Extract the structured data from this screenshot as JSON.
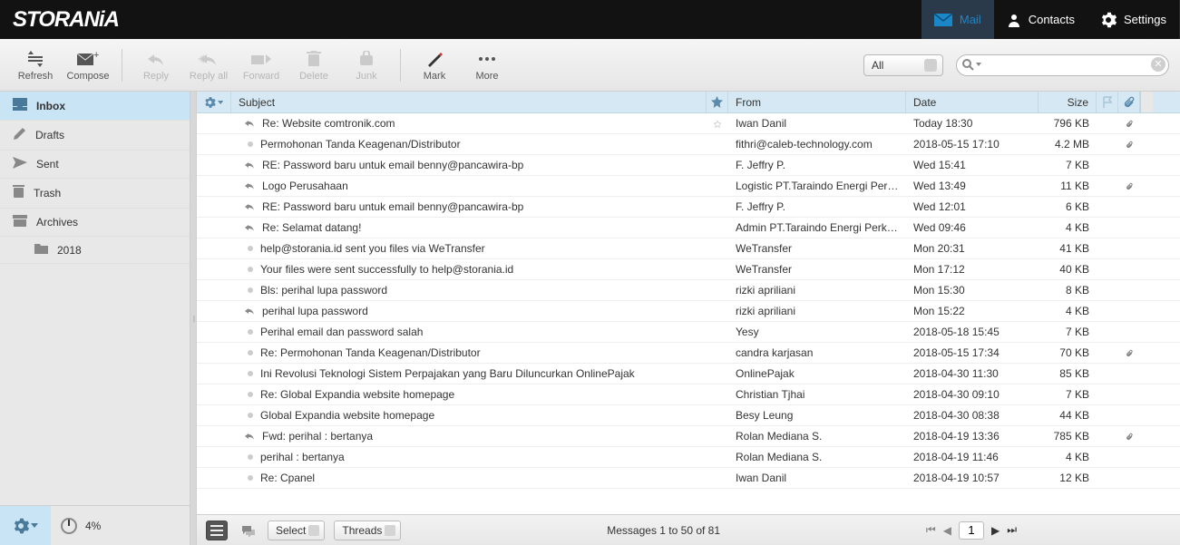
{
  "app": {
    "name": "STORANiA"
  },
  "topnav": {
    "mail": "Mail",
    "contacts": "Contacts",
    "settings": "Settings"
  },
  "toolbar": {
    "refresh": "Refresh",
    "compose": "Compose",
    "reply": "Reply",
    "reply_all": "Reply all",
    "forward": "Forward",
    "delete": "Delete",
    "junk": "Junk",
    "mark": "Mark",
    "more": "More",
    "filter_value": "All",
    "search_placeholder": ""
  },
  "sidebar": {
    "folders": [
      {
        "name": "Inbox",
        "icon": "inbox",
        "selected": true
      },
      {
        "name": "Drafts",
        "icon": "pencil"
      },
      {
        "name": "Sent",
        "icon": "sent"
      },
      {
        "name": "Trash",
        "icon": "trash"
      },
      {
        "name": "Archives",
        "icon": "archive"
      },
      {
        "name": "2018",
        "icon": "folder",
        "sub": true
      }
    ],
    "quota_pct": "4%"
  },
  "columns": {
    "subject": "Subject",
    "from": "From",
    "date": "Date",
    "size": "Size"
  },
  "messages": [
    {
      "replied": true,
      "subject": "Re: Website comtronik.com",
      "from": "Iwan Danil",
      "date": "Today 18:30",
      "size": "796 KB",
      "star": true,
      "attachment": true
    },
    {
      "replied": false,
      "subject": "Permohonan Tanda Keagenan/Distributor",
      "from": "fithri@caleb-technology.com",
      "date": "2018-05-15 17:10",
      "size": "4.2 MB",
      "attachment": true
    },
    {
      "replied": true,
      "subject": "RE: Password baru untuk email benny@pancawira-bp",
      "from": "F. Jeffry P.",
      "date": "Wed 15:41",
      "size": "7 KB"
    },
    {
      "replied": true,
      "subject": "Logo Perusahaan",
      "from": "Logistic PT.Taraindo Energi Perkasa",
      "date": "Wed 13:49",
      "size": "11 KB",
      "attachment": true
    },
    {
      "replied": true,
      "subject": "RE: Password baru untuk email benny@pancawira-bp",
      "from": "F. Jeffry P.",
      "date": "Wed 12:01",
      "size": "6 KB"
    },
    {
      "replied": true,
      "subject": "Re: Selamat datang!",
      "from": "Admin PT.Taraindo Energi Perkasa",
      "date": "Wed 09:46",
      "size": "4 KB"
    },
    {
      "replied": false,
      "subject": "help@storania.id sent you files via WeTransfer",
      "from": "WeTransfer",
      "date": "Mon 20:31",
      "size": "41 KB"
    },
    {
      "replied": false,
      "subject": "Your files were sent successfully to help@storania.id",
      "from": "WeTransfer",
      "date": "Mon 17:12",
      "size": "40 KB"
    },
    {
      "replied": false,
      "subject": "Bls: perihal lupa password",
      "from": "rizki apriliani",
      "date": "Mon 15:30",
      "size": "8 KB"
    },
    {
      "replied": true,
      "subject": "perihal lupa password",
      "from": "rizki apriliani",
      "date": "Mon 15:22",
      "size": "4 KB"
    },
    {
      "replied": false,
      "subject": "Perihal email dan password salah",
      "from": "Yesy",
      "date": "2018-05-18 15:45",
      "size": "7 KB"
    },
    {
      "replied": false,
      "subject": "Re: Permohonan Tanda Keagenan/Distributor",
      "from": "candra karjasan",
      "date": "2018-05-15 17:34",
      "size": "70 KB",
      "attachment": true
    },
    {
      "replied": false,
      "subject": "Ini Revolusi Teknologi Sistem Perpajakan yang Baru Diluncurkan OnlinePajak",
      "from": "OnlinePajak",
      "date": "2018-04-30 11:30",
      "size": "85 KB"
    },
    {
      "replied": false,
      "subject": "Re: Global Expandia website homepage",
      "from": "Christian Tjhai",
      "date": "2018-04-30 09:10",
      "size": "7 KB"
    },
    {
      "replied": false,
      "subject": "Global Expandia website homepage",
      "from": "Besy Leung",
      "date": "2018-04-30 08:38",
      "size": "44 KB"
    },
    {
      "replied": true,
      "subject": "Fwd: perihal : bertanya",
      "from": "Rolan Mediana S.",
      "date": "2018-04-19 13:36",
      "size": "785 KB",
      "attachment": true
    },
    {
      "replied": false,
      "subject": "perihal : bertanya",
      "from": "Rolan Mediana S.",
      "date": "2018-04-19 11:46",
      "size": "4 KB"
    },
    {
      "replied": false,
      "subject": "Re: Cpanel",
      "from": "Iwan Danil",
      "date": "2018-04-19 10:57",
      "size": "12 KB"
    }
  ],
  "statusbar": {
    "select_label": "Select",
    "threads_label": "Threads",
    "status": "Messages 1 to 50 of 81",
    "page": "1"
  }
}
